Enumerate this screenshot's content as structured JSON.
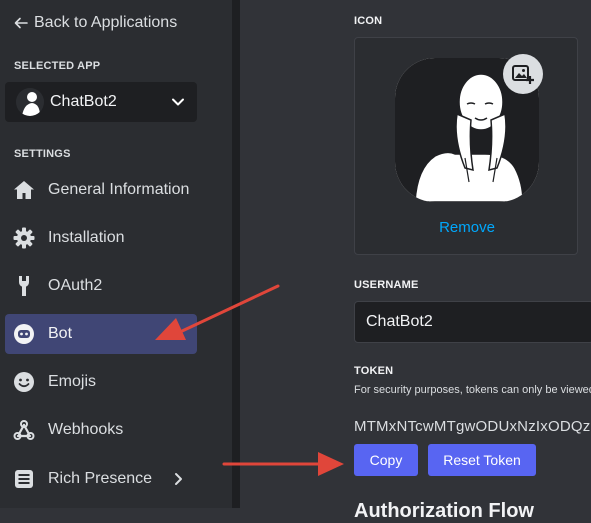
{
  "sidebar": {
    "back_label": "Back to Applications",
    "selected_app_heading": "SELECTED APP",
    "selected_app_name": "ChatBot2",
    "settings_heading": "SETTINGS",
    "items": [
      {
        "label": "General Information",
        "icon": "home-icon"
      },
      {
        "label": "Installation",
        "icon": "gear-icon"
      },
      {
        "label": "OAuth2",
        "icon": "wrench-icon"
      },
      {
        "label": "Bot",
        "icon": "bot-icon",
        "active": true
      },
      {
        "label": "Emojis",
        "icon": "smiley-icon"
      },
      {
        "label": "Webhooks",
        "icon": "webhook-icon"
      },
      {
        "label": "Rich Presence",
        "icon": "list-icon",
        "has_submenu": true
      }
    ]
  },
  "main": {
    "icon_heading": "ICON",
    "remove_label": "Remove",
    "username_heading": "USERNAME",
    "username_value": "ChatBot2",
    "token_heading": "TOKEN",
    "token_description": "For security purposes, tokens can only be viewed",
    "token_value": "MTMxNTcwMTgwODUxNzIxODQzO",
    "copy_label": "Copy",
    "reset_label": "Reset Token",
    "next_heading": "Authorization Flow"
  },
  "colors": {
    "accent": "#5865f2",
    "link": "#00a8fc",
    "active_nav": "#404675",
    "annotation_arrow": "#e0463a"
  }
}
